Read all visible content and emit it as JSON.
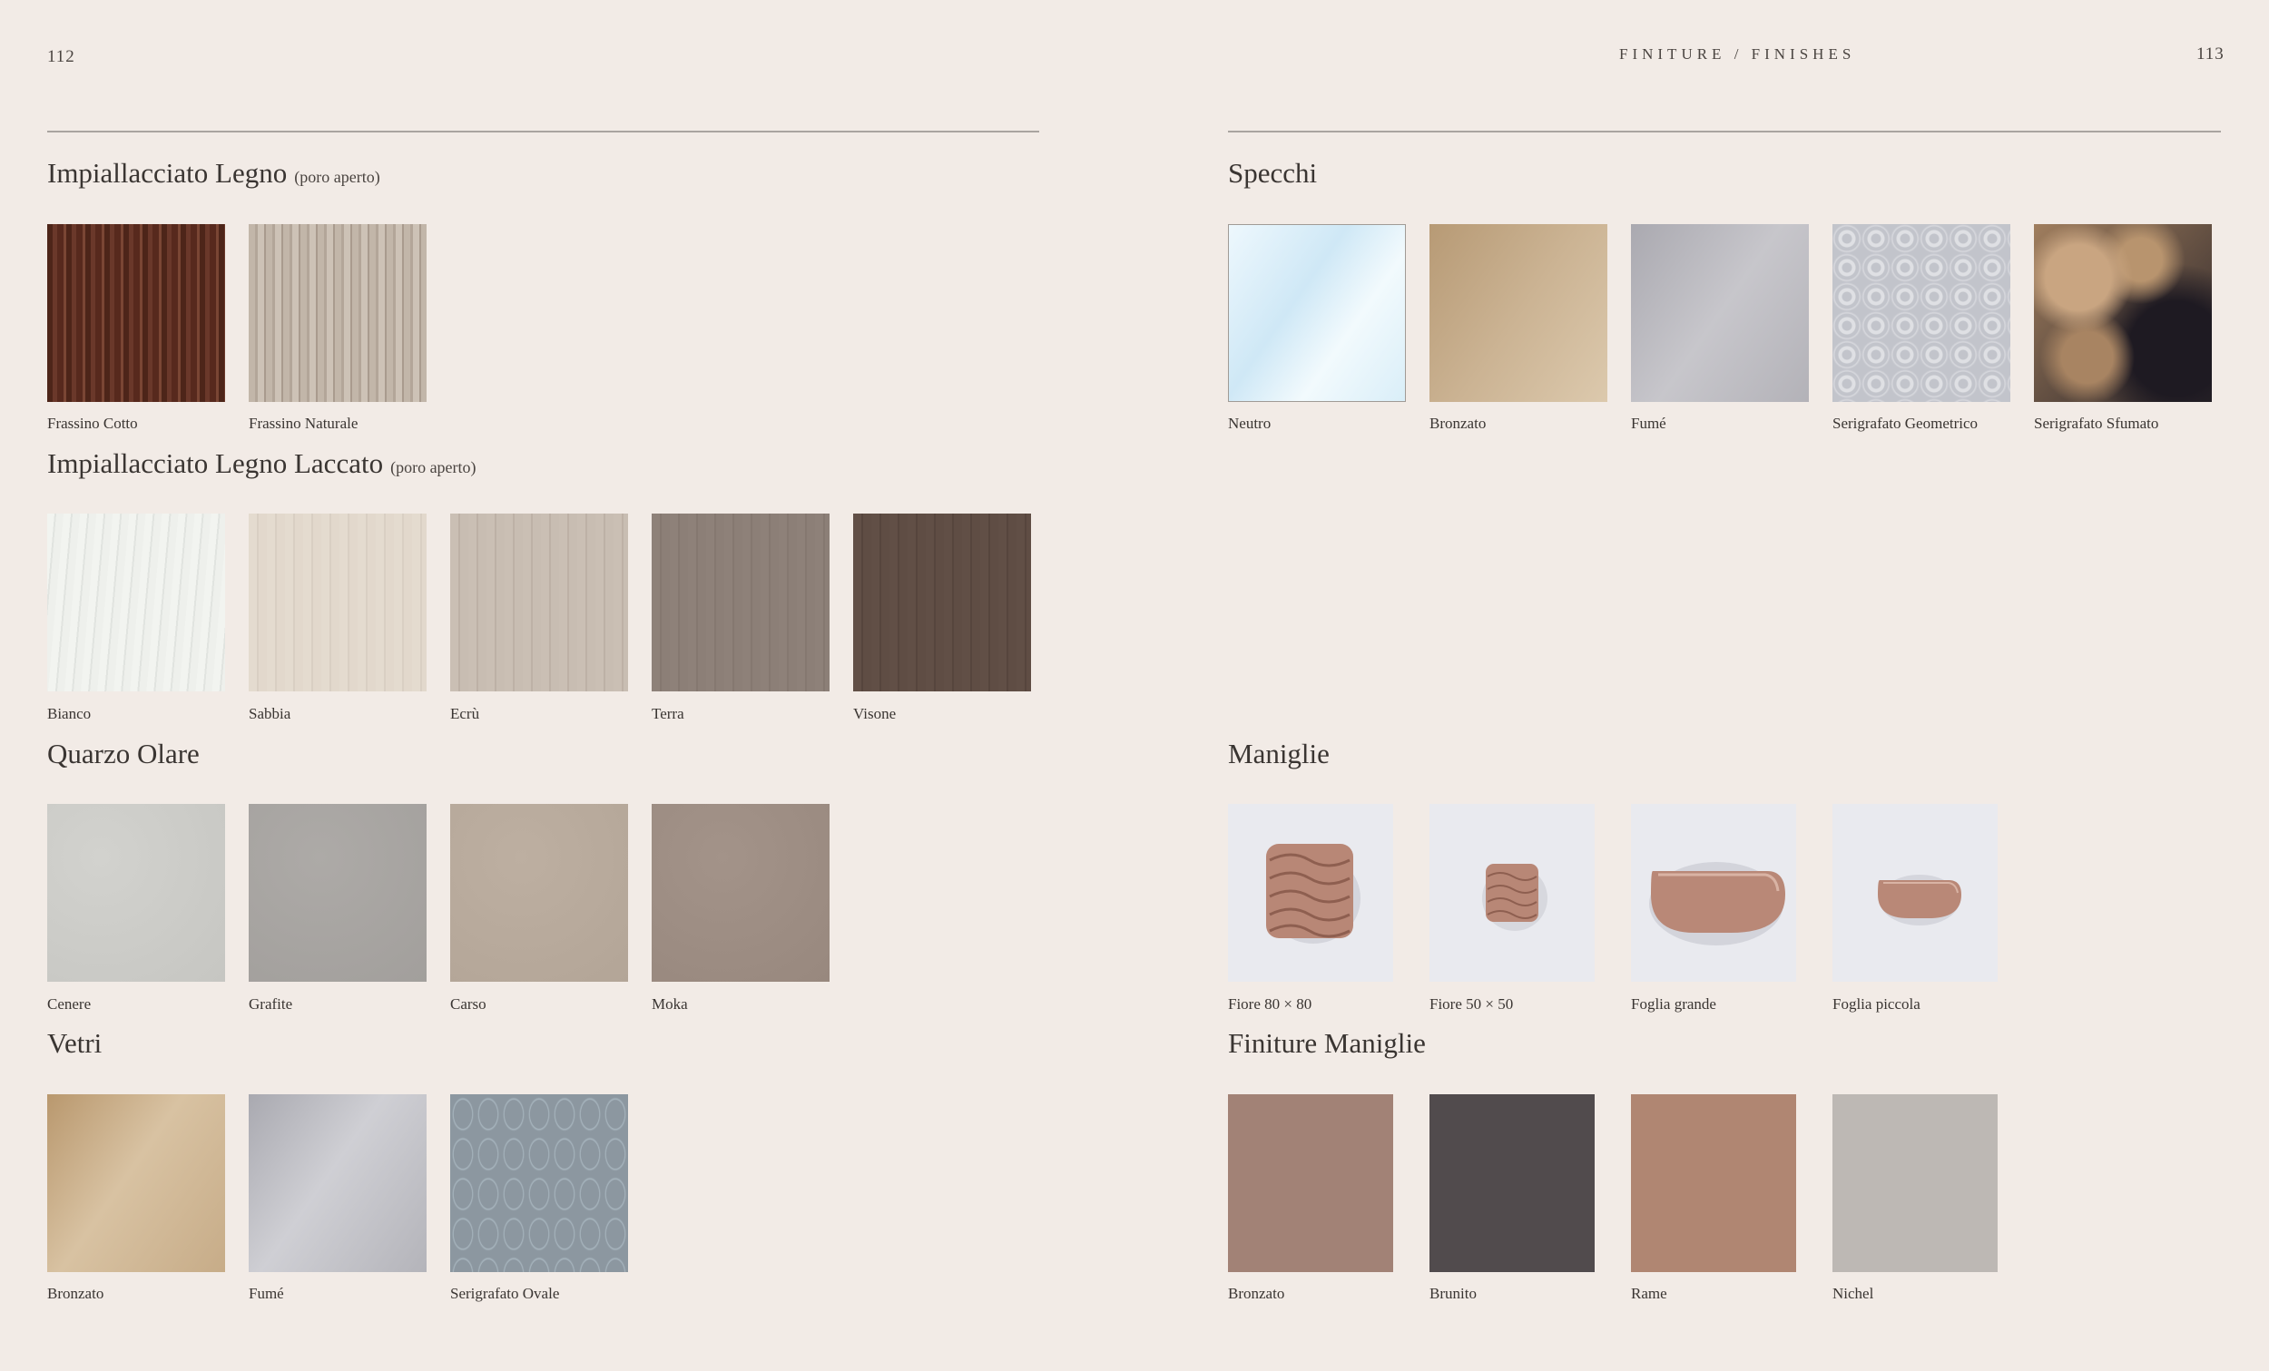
{
  "header": {
    "left_page_number": "112",
    "right_page_number": "113",
    "title": "FINITURE / FINISHES"
  },
  "sections": {
    "legno": {
      "title": "Impiallacciato Legno",
      "subtitle": "(poro aperto)",
      "items": [
        {
          "label": "Frassino Cotto",
          "color": "#5a2f22"
        },
        {
          "label": "Frassino Naturale",
          "color": "#c4b8ab"
        }
      ]
    },
    "laccato": {
      "title": "Impiallacciato Legno Laccato",
      "subtitle": "(poro aperto)",
      "items": [
        {
          "label": "Bianco",
          "color": "#eef0ec"
        },
        {
          "label": "Sabbia",
          "color": "#e2d8cc"
        },
        {
          "label": "Ecrù",
          "color": "#c8bdb2"
        },
        {
          "label": "Terra",
          "color": "#8c7f77"
        },
        {
          "label": "Visone",
          "color": "#5f4d44"
        }
      ]
    },
    "quarzo": {
      "title": "Quarzo Olare",
      "items": [
        {
          "label": "Cenere",
          "color": "#cbcbc7"
        },
        {
          "label": "Grafite",
          "color": "#a7a4a1"
        },
        {
          "label": "Carso",
          "color": "#b8aa9c"
        },
        {
          "label": "Moka",
          "color": "#9e8e84"
        }
      ]
    },
    "vetri": {
      "title": "Vetri",
      "items": [
        {
          "label": "Bronzato",
          "color": "#c4aa88"
        },
        {
          "label": "Fumé",
          "color": "#b6b6bc"
        },
        {
          "label": "Serigrafato Ovale",
          "color": "#8f9aa3"
        }
      ]
    },
    "specchi": {
      "title": "Specchi",
      "items": [
        {
          "label": "Neutro",
          "color": "#d8ecf6"
        },
        {
          "label": "Bronzato",
          "color": "#c8ae8c"
        },
        {
          "label": "Fumé",
          "color": "#b5b4ba"
        },
        {
          "label": "Serigrafato Geometrico",
          "color": "#bfc1c8"
        },
        {
          "label": "Serigrafato Sfumato",
          "color": "#4a3a2e"
        }
      ]
    },
    "maniglie": {
      "title": "Maniglie",
      "items": [
        {
          "label": "Fiore 80 × 80",
          "shape": "square-large"
        },
        {
          "label": "Fiore 50 × 50",
          "shape": "square-small"
        },
        {
          "label": "Foglia grande",
          "shape": "leaf-large"
        },
        {
          "label": "Foglia piccola",
          "shape": "leaf-small"
        }
      ],
      "handle_color": "#b98a78",
      "background_color": "#e8e9ee"
    },
    "finiture_maniglie": {
      "title": "Finiture Maniglie",
      "items": [
        {
          "label": "Bronzato",
          "color": "#a28276"
        },
        {
          "label": "Brunito",
          "color": "#514b4d"
        },
        {
          "label": "Rame",
          "color": "#b08672"
        },
        {
          "label": "Nichel",
          "color": "#bdb8b4"
        }
      ]
    }
  }
}
